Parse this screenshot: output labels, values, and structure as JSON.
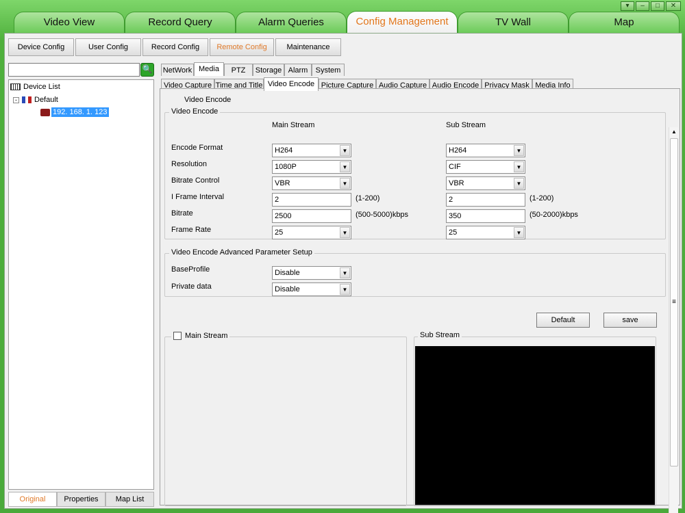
{
  "main_tabs": [
    "Video View",
    "Record Query",
    "Alarm Queries",
    "Config Management",
    "TV Wall",
    "Map"
  ],
  "top_buttons": [
    "Device Config",
    "User Config",
    "Record Config",
    "Remote Config",
    "Maintenance"
  ],
  "tree": {
    "root": "Device List",
    "group": "Default",
    "device": "192. 168. 1. 123"
  },
  "search": {
    "button": "🔍",
    "value": ""
  },
  "left_tabs": [
    "Original",
    "Properties",
    "Map List"
  ],
  "category_tabs": [
    "NetWork",
    "Media",
    "PTZ",
    "Storage",
    "Alarm",
    "System"
  ],
  "media_tabs": [
    "Video Capture",
    "Time and Title",
    "Video Encode",
    "Picture Capture",
    "Audio Capture",
    "Audio Encode",
    "Privacy Mask",
    "Media Info"
  ],
  "page_label": "Video Encode",
  "encode": {
    "legend": "Video Encode",
    "main_header": "Main Stream",
    "sub_header": "Sub Stream",
    "rows": [
      {
        "label": "Encode Format",
        "main": "H264",
        "sub": "H264",
        "type": "combo",
        "hint_main": "",
        "hint_sub": ""
      },
      {
        "label": "Resolution",
        "main": "1080P",
        "sub": "CIF",
        "type": "combo",
        "hint_main": "",
        "hint_sub": ""
      },
      {
        "label": "Bitrate Control",
        "main": "VBR",
        "sub": "VBR",
        "type": "combo",
        "hint_main": "",
        "hint_sub": ""
      },
      {
        "label": "I Frame Interval",
        "main": "2",
        "sub": "2",
        "type": "text",
        "hint_main": "(1-200)",
        "hint_sub": "(1-200)"
      },
      {
        "label": "Bitrate",
        "main": "2500",
        "sub": "350",
        "type": "text",
        "hint_main": "(500-5000)kbps",
        "hint_sub": "(50-2000)kbps"
      },
      {
        "label": "Frame Rate",
        "main": "25",
        "sub": "25",
        "type": "combo",
        "hint_main": "",
        "hint_sub": ""
      }
    ]
  },
  "advanced": {
    "legend": "Video Encode Advanced Parameter Setup",
    "rows": [
      {
        "label": "BaseProfile",
        "value": "Disable"
      },
      {
        "label": "Private data",
        "value": "Disable"
      }
    ]
  },
  "buttons": {
    "default": "Default",
    "save": "save"
  },
  "preview": {
    "main_label": "Main Stream",
    "main_checked": false,
    "sub_label": "Sub Stream"
  },
  "window_controls": [
    "▾",
    "–",
    "□",
    "✕"
  ],
  "scroll_glyphs": {
    "up": "▲",
    "down": "▼",
    "left": "◄",
    "right": "►",
    "grip_v": "≡",
    "grip_h": "⁞⁞"
  }
}
